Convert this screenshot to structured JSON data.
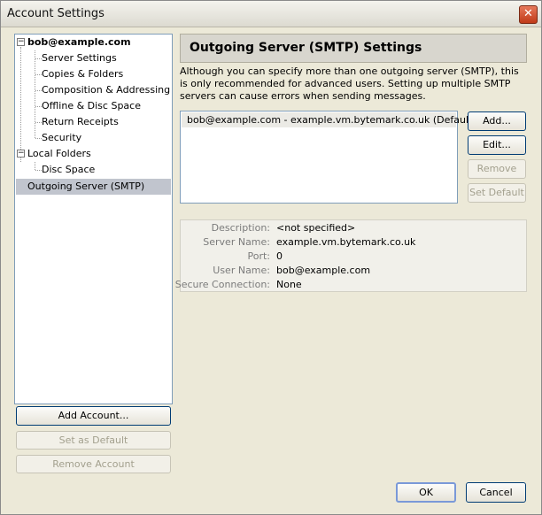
{
  "window": {
    "title": "Account Settings",
    "close_glyph": "✕"
  },
  "tree": {
    "account": {
      "label": "bob@example.com",
      "expander": "−",
      "children": [
        "Server Settings",
        "Copies & Folders",
        "Composition & Addressing",
        "Offline & Disc Space",
        "Return Receipts",
        "Security"
      ]
    },
    "local_folders": {
      "label": "Local Folders",
      "expander": "−",
      "children": [
        "Disc Space"
      ]
    },
    "outgoing": {
      "label": "Outgoing Server (SMTP)"
    }
  },
  "left_buttons": {
    "add_account": "Add Account...",
    "set_default": "Set as Default",
    "remove_account": "Remove Account"
  },
  "main": {
    "header": "Outgoing Server (SMTP) Settings",
    "description": "Although you can specify more than one outgoing server (SMTP), this is only recommended for advanced users. Setting up multiple SMTP servers can cause errors when sending messages.",
    "servers": [
      "bob@example.com - example.vm.bytemark.co.uk (Default)"
    ],
    "buttons": {
      "add": "Add...",
      "edit": "Edit...",
      "remove": "Remove",
      "set_default": "Set Default"
    },
    "details": [
      {
        "label": "Description:",
        "value": "<not specified>"
      },
      {
        "label": "Server Name:",
        "value": "example.vm.bytemark.co.uk"
      },
      {
        "label": "Port:",
        "value": "0"
      },
      {
        "label": "User Name:",
        "value": "bob@example.com"
      },
      {
        "label": "Secure Connection:",
        "value": "None"
      }
    ]
  },
  "footer": {
    "ok": "OK",
    "cancel": "Cancel"
  }
}
